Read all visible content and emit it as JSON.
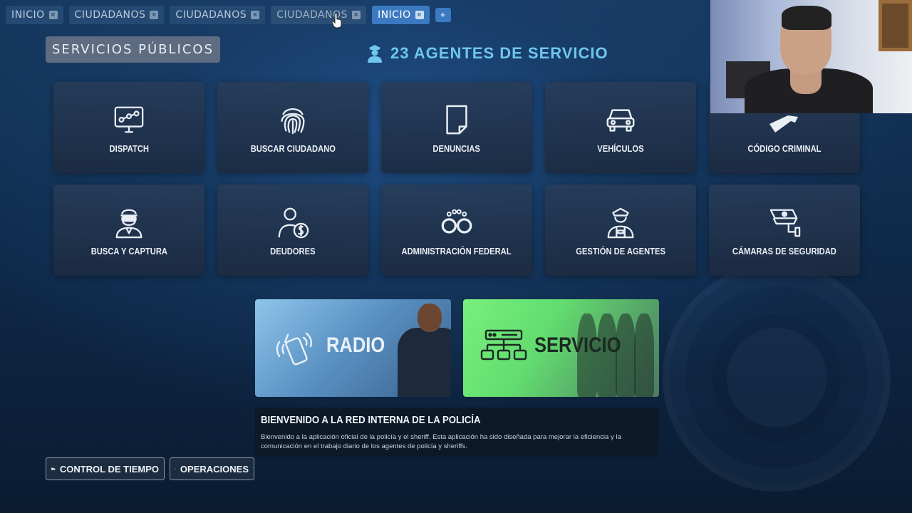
{
  "tabs": [
    {
      "label": "INICIO",
      "state": "normal"
    },
    {
      "label": "CIUDADANOS",
      "state": "normal"
    },
    {
      "label": "CIUDADANOS",
      "state": "normal"
    },
    {
      "label": "CIUDADANOS",
      "state": "faded"
    },
    {
      "label": "INICIO",
      "state": "active"
    }
  ],
  "tab_add_label": "+",
  "header": {
    "section_label": "SERVICIOS PÚBLICOS",
    "agents_on_duty": "23 AGENTES DE SERVICIO",
    "agents_icon": "police-officer-icon"
  },
  "tiles": [
    {
      "label": "DISPATCH",
      "icon": "monitor-route-icon"
    },
    {
      "label": "BUSCAR CIUDADANO",
      "icon": "fingerprint-icon"
    },
    {
      "label": "DENUNCIAS",
      "icon": "document-icon"
    },
    {
      "label": "VEHÍCULOS",
      "icon": "car-icon"
    },
    {
      "label": "CÓDIGO CRIMINAL",
      "icon": "gavel-icon"
    },
    {
      "label": "BUSCA Y CAPTURA",
      "icon": "masked-thief-icon"
    },
    {
      "label": "DEUDORES",
      "icon": "person-dollar-icon"
    },
    {
      "label": "ADMINISTRACIÓN FEDERAL",
      "icon": "handcuffs-icon"
    },
    {
      "label": "GESTIÓN DE AGENTES",
      "icon": "police-officer-icon"
    },
    {
      "label": "CÁMARAS DE SEGURIDAD",
      "icon": "security-camera-icon"
    }
  ],
  "cards": {
    "radio": {
      "label": "RADIO",
      "icon": "walkie-talkie-icon"
    },
    "service": {
      "label": "SERVICIO",
      "icon": "network-icon"
    }
  },
  "welcome": {
    "title": "BIENVENIDO A LA RED INTERNA DE LA POLICÍA",
    "text": "Bienvenido a la aplicación oficial de la policía y el sheriff. Esta aplicación ha sido diseñada para mejorar la eficiencia y la comunicación en el trabajo diario de los agentes de policía y sheriffs."
  },
  "bottom_buttons": {
    "time_control": "CONTROL DE TIEMPO",
    "operations": "OPERACIONES"
  },
  "colors": {
    "accent": "#3b7ac0",
    "agents_title": "#6fc6ee",
    "service_card": "#6fe87a"
  }
}
